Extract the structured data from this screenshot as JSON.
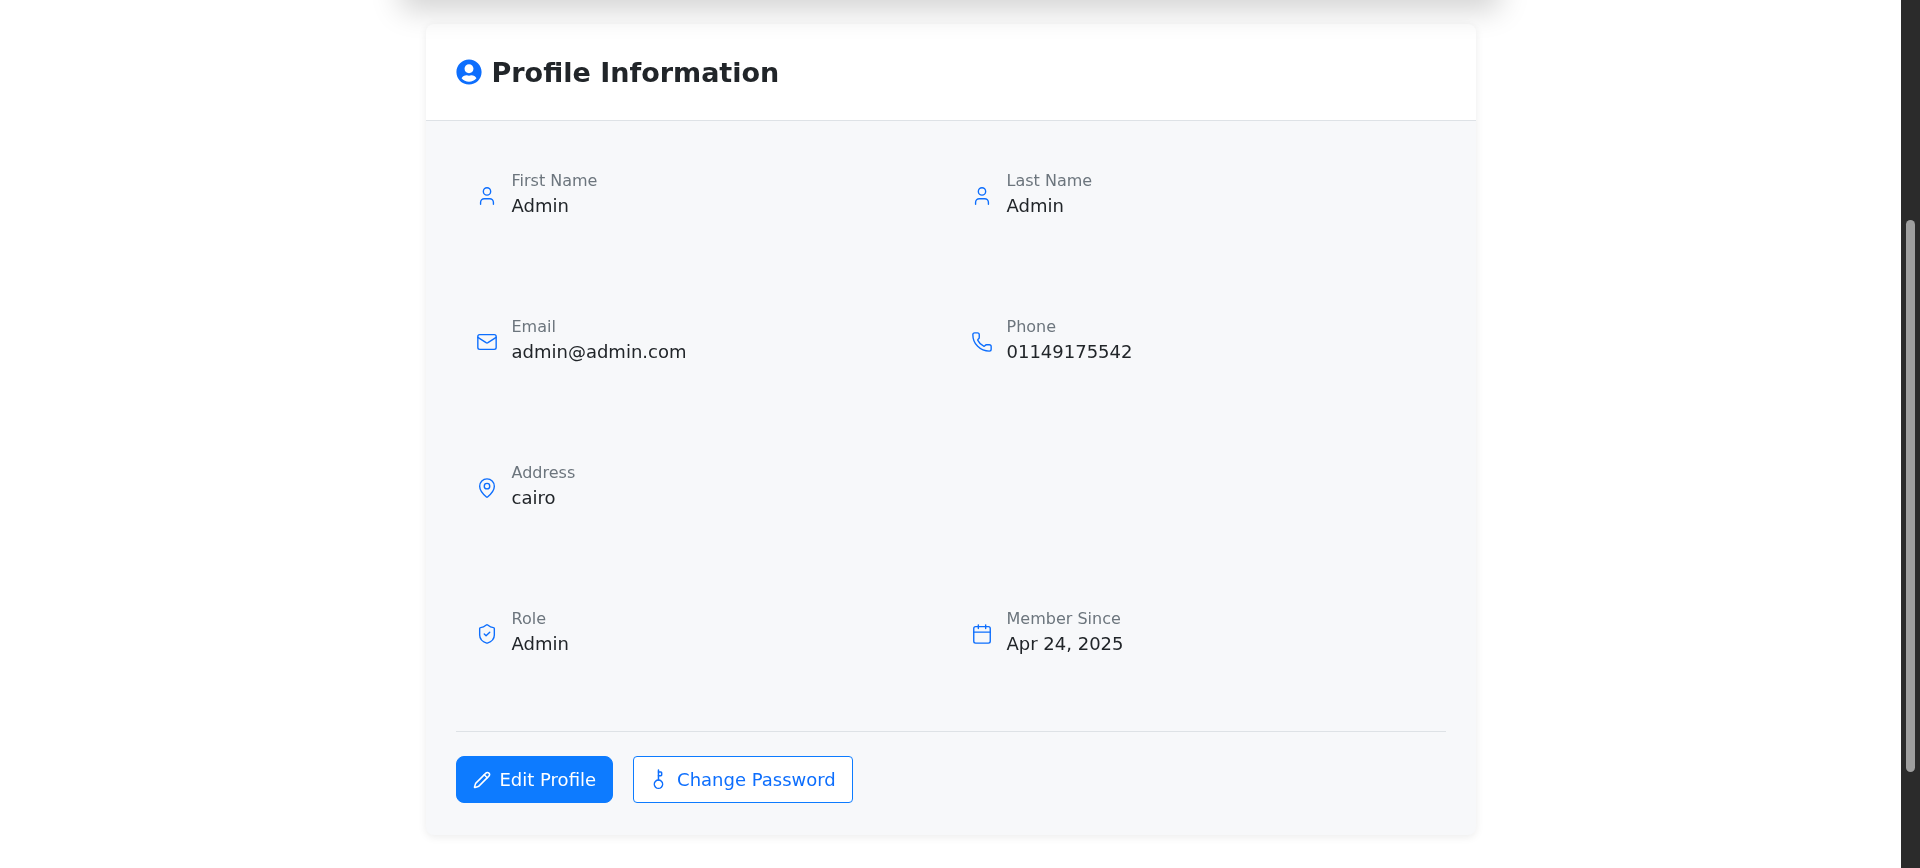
{
  "card": {
    "title": "Profile Information",
    "rows": [
      [
        {
          "kind": "person",
          "label": "First Name",
          "value": "Admin"
        },
        {
          "kind": "person",
          "label": "Last Name",
          "value": "Admin"
        }
      ],
      [
        {
          "kind": "email",
          "label": "Email",
          "value": "admin@admin.com"
        },
        {
          "kind": "phone",
          "label": "Phone",
          "value": "01149175542"
        }
      ],
      [
        {
          "kind": "location",
          "label": "Address",
          "value": "cairo"
        }
      ],
      [
        {
          "kind": "role",
          "label": "Role",
          "value": "Admin"
        },
        {
          "kind": "date",
          "label": "Member Since",
          "value": "Apr 24, 2025"
        }
      ]
    ],
    "buttons": [
      {
        "kind": "primary",
        "label": "Edit Profile"
      },
      {
        "kind": "outline",
        "label": "Change Password"
      }
    ]
  }
}
